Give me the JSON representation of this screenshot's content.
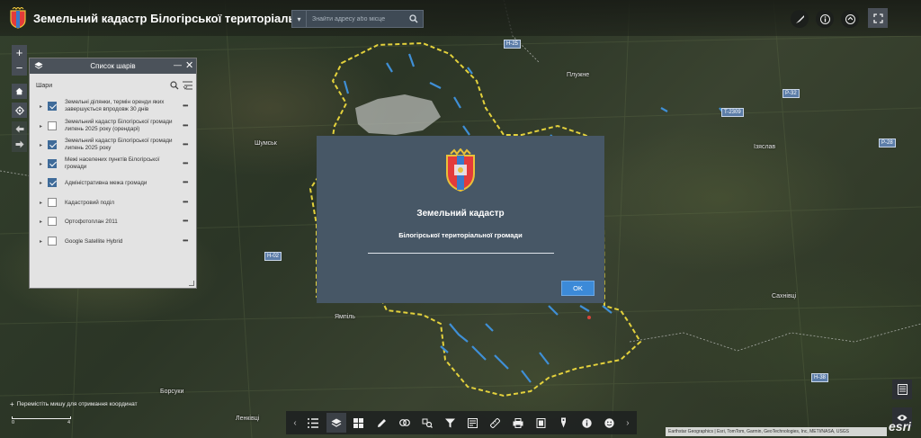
{
  "header": {
    "title": "Земельний кадастр Білогірської територіальної громади",
    "search_placeholder": "Знайти адресу або місце",
    "icons": [
      "brush-icon",
      "info-icon",
      "share-icon",
      "fullscreen-icon"
    ]
  },
  "map_controls": {
    "zoom_in": "+",
    "zoom_out": "−"
  },
  "layer_panel": {
    "title": "Список шарів",
    "section_label": "Шари",
    "layers": [
      {
        "label": "Земельні ділянки, термін оренди яких завершується впродовж 30 днів",
        "checked": true
      },
      {
        "label": "Земельний кадастр Білогірської громади липень 2025 року (орендарі)",
        "checked": false
      },
      {
        "label": "Земельний кадастр Білогірської громади липень 2025 року",
        "checked": true
      },
      {
        "label": "Межі населених пунктів Білогірської громади",
        "checked": true
      },
      {
        "label": "Адміністративна межа громади",
        "checked": true
      },
      {
        "label": "Кадастровий поділ",
        "checked": false
      },
      {
        "label": "Ортофотоплан 2011",
        "checked": false
      },
      {
        "label": "Google Satellite Hybrid",
        "checked": false
      }
    ]
  },
  "modal": {
    "title": "Земельний кадастр",
    "subtitle": "Білогірської територіальної громади",
    "ok_label": "OK"
  },
  "coord_hint": "Перемістіть мишу для отримання координат",
  "scalebar": {
    "left": "0",
    "right": "4"
  },
  "attribution": "Earthstar Geographics | Esri, TomTom, Garmin, GeoTechnologies, Inc, METI/NASA, USGS",
  "esri_logo": "esri",
  "map_labels": [
    {
      "text": "Плужне"
    },
    {
      "text": "Шумськ"
    },
    {
      "text": "Ізяслав"
    },
    {
      "text": "Ямпіль"
    },
    {
      "text": "Сахнівці"
    },
    {
      "text": "Борсуки"
    },
    {
      "text": "Ленківці"
    }
  ],
  "road_badges": [
    "H-25",
    "P-32",
    "T-2309",
    "P-28",
    "H-02",
    "H-38"
  ],
  "colors": {
    "boundary": "#e3d13c",
    "parcels": "#3f8fd6",
    "panel_header": "#4b525a",
    "modal_bg": "#475766",
    "ok_button": "#3c8ad8"
  }
}
